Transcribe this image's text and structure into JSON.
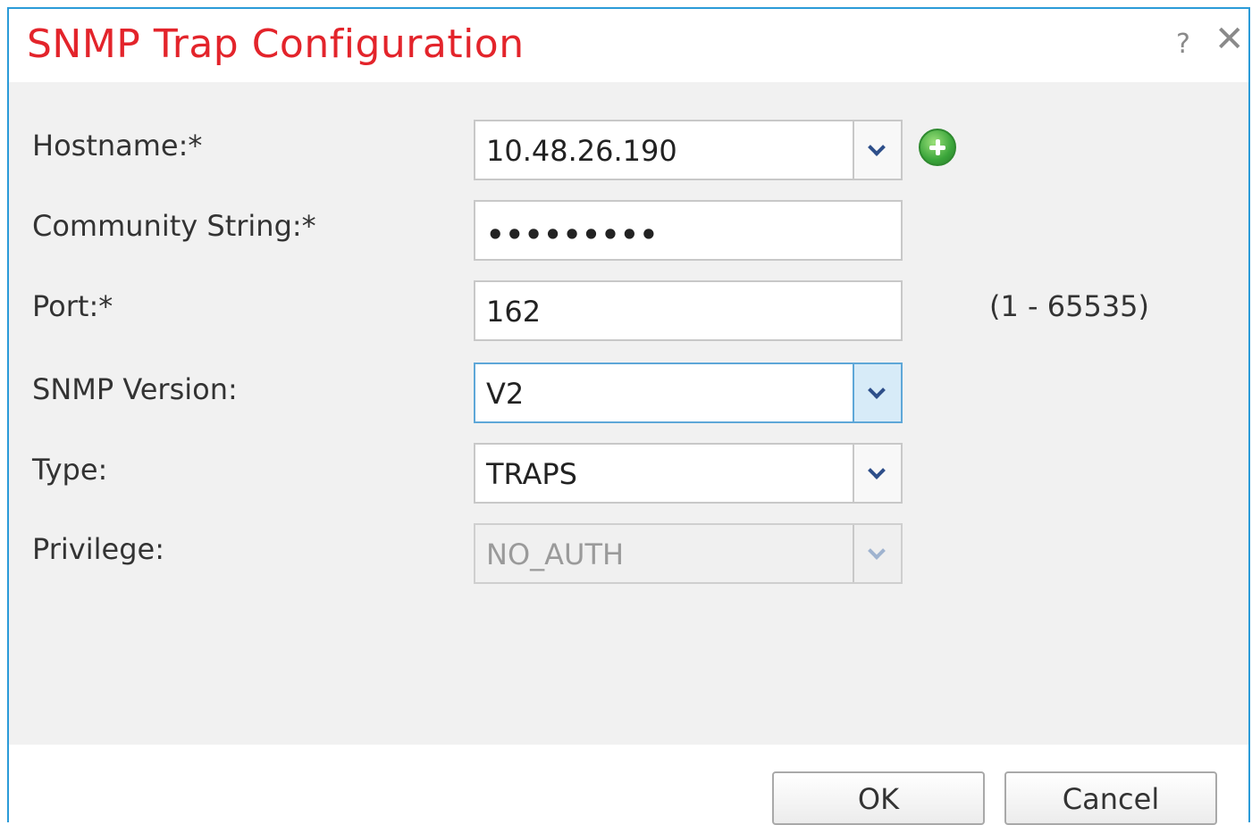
{
  "dialog": {
    "title": "SNMP Trap Configuration",
    "help_label": "?",
    "close_label": "✕"
  },
  "form": {
    "hostname": {
      "label": "Hostname:*",
      "value": "10.48.26.190"
    },
    "community": {
      "label": "Community String:*",
      "value": "•••••••••"
    },
    "port": {
      "label": "Port:*",
      "value": "162",
      "range": "(1 - 65535)"
    },
    "version": {
      "label": "SNMP Version:",
      "value": "V2"
    },
    "type": {
      "label": "Type:",
      "value": "TRAPS"
    },
    "privilege": {
      "label": "Privilege:",
      "value": "NO_AUTH"
    }
  },
  "buttons": {
    "ok": "OK",
    "cancel": "Cancel"
  },
  "colors": {
    "title": "#e3242b",
    "border": "#2b9bd8",
    "add_icon": "#3aa53a"
  },
  "icons": {
    "help": "help-icon",
    "close": "close-icon",
    "add": "plus-circle-icon",
    "dropdown": "chevron-down-icon"
  }
}
